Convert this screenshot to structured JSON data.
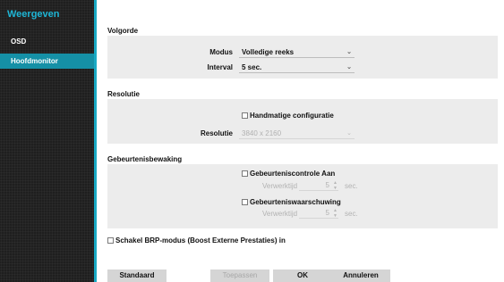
{
  "sidebar": {
    "title": "Weergeven",
    "items": [
      {
        "label": "OSD"
      },
      {
        "label": "Hoofdmonitor"
      }
    ]
  },
  "sections": {
    "volgorde": {
      "title": "Volgorde",
      "modus_label": "Modus",
      "modus_value": "Volledige reeks",
      "interval_label": "Interval",
      "interval_value": "5 sec."
    },
    "resolutie": {
      "title": "Resolutie",
      "manual_config_label": "Handmatige configuratie",
      "resolutie_label": "Resolutie",
      "resolutie_value": "3840 x 2160"
    },
    "gebeurtenis": {
      "title": "Gebeurtenisbewaking",
      "control_label": "Gebeurteniscontrole Aan",
      "control_wait_label": "Verwerktijd",
      "control_wait_value": "5",
      "control_unit": "sec.",
      "warning_label": "Gebeurteniswaarschuwing",
      "warning_wait_label": "Verwerktijd",
      "warning_wait_value": "5",
      "warning_unit": "sec."
    }
  },
  "brp_label": "Schakel BRP-modus (Boost Externe Prestaties) in",
  "buttons": {
    "default": "Standaard",
    "apply": "Toepassen",
    "ok": "OK",
    "cancel": "Annuleren"
  },
  "colors": {
    "accent": "#19a9c4",
    "sidebar_bg": "#1f1f1f",
    "selected_item_bg": "#1590a6",
    "panel_bg": "#ececec",
    "button_bg": "#d5d5d5"
  }
}
